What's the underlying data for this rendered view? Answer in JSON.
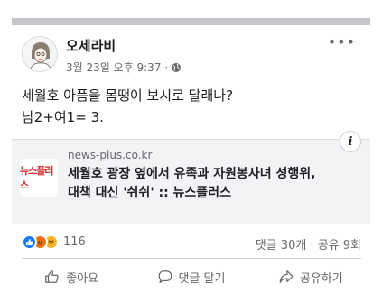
{
  "post": {
    "author": "오세라비",
    "timestamp": "3월 23일 오후 9:37 ·",
    "privacy_icon": "globe-icon",
    "more_label": "•••",
    "text_lines": [
      "세월호 아픔을 몸땡이 보시로 달래나?",
      "남2+여1= 3."
    ]
  },
  "link_preview": {
    "domain": "news-plus.co.kr",
    "headline_lines": [
      "세월호 광장 옆에서 유족과 자원봉사녀 성행위,",
      "대책 대신 '쉬쉬' :: 뉴스플러스"
    ],
    "thumb_text": "뉴스플러스",
    "info_label": "i"
  },
  "stats": {
    "reaction_count": "116",
    "comments_shares": "댓글 30개 · 공유 9회",
    "reactions": [
      "like",
      "angry",
      "haha"
    ]
  },
  "actions": {
    "like_label": "좋아요",
    "comment_label": "댓글 달기",
    "share_label": "공유하기"
  },
  "colors": {
    "accent": "#1877f2",
    "secondary_text": "#65676b",
    "primary_text": "#1c1e21",
    "link_bg": "#f2f3f5"
  }
}
